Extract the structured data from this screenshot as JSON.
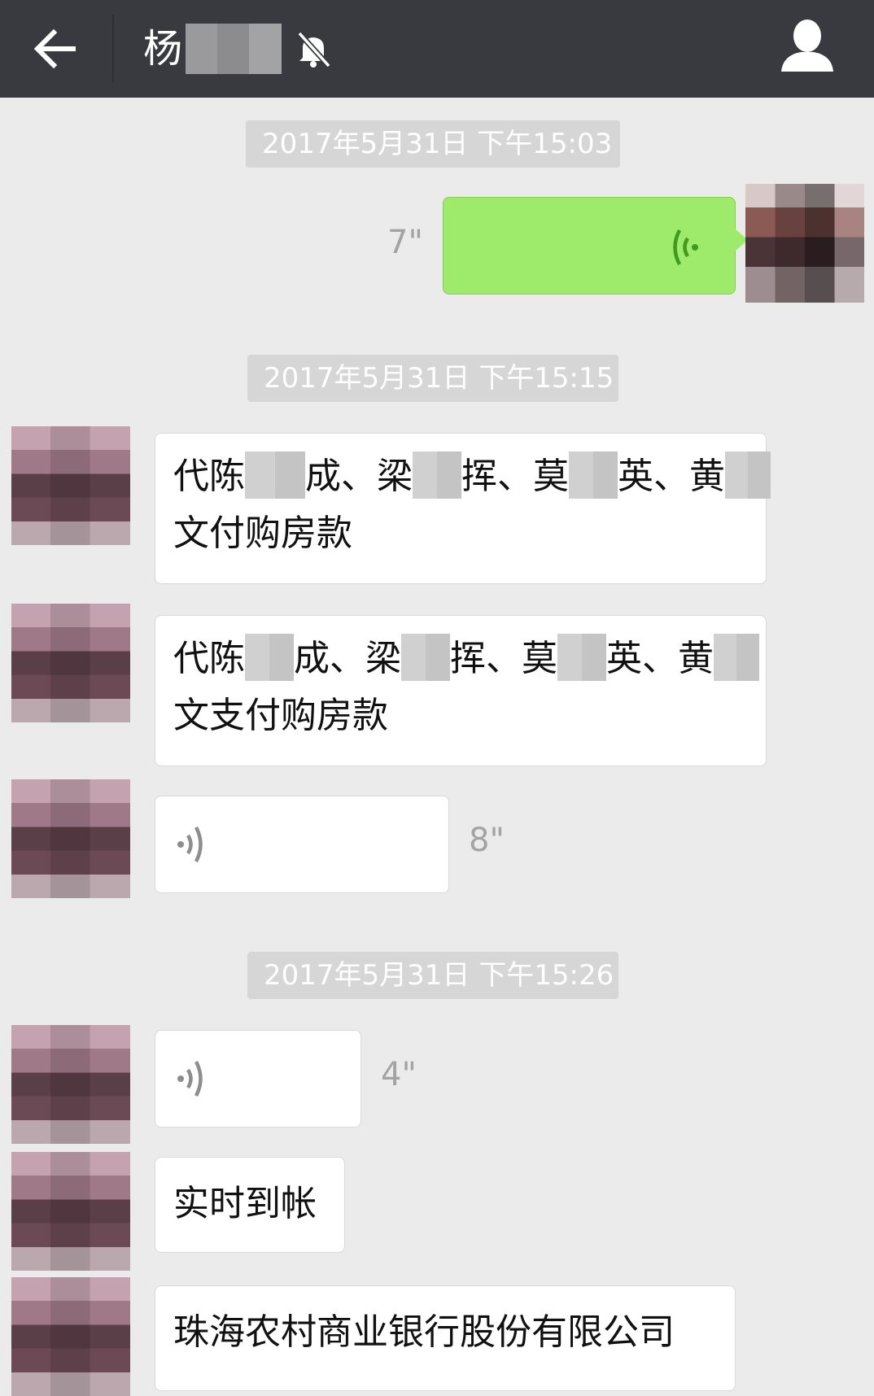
{
  "header": {
    "title_visible": "杨",
    "icons": {
      "back": "arrow-left-icon",
      "mute": "bell-off-icon",
      "profile": "person-icon"
    }
  },
  "colors": {
    "header_bg": "#393a3f",
    "chat_bg": "#ebebeb",
    "sent_bubble": "#9eea6a",
    "timestamp_bg": "#d6d6d6",
    "voice_sent_icon": "#3f9a1e",
    "voice_recv_icon": "#8d8d8d"
  },
  "messages": {
    "ts1": "2017年5月31日 下午15:03",
    "sent_voice": {
      "duration": "7\""
    },
    "ts2": "2017年5月31日 下午15:15",
    "m1": {
      "a": "代陈",
      "b": "成、梁",
      "c": "挥、莫",
      "d": "英、黄",
      "line2": "文付购房款"
    },
    "m2": {
      "a": "代陈",
      "b": "成、梁",
      "c": "挥、莫",
      "d": "英、黄",
      "line2": "文支付购房款"
    },
    "recv_voice_1": {
      "duration": "8\""
    },
    "ts3": "2017年5月31日 下午15:26",
    "recv_voice_2": {
      "duration": "4\""
    },
    "m3": "实时到帐",
    "m4": "珠海农村商业银行股份有限公司"
  }
}
